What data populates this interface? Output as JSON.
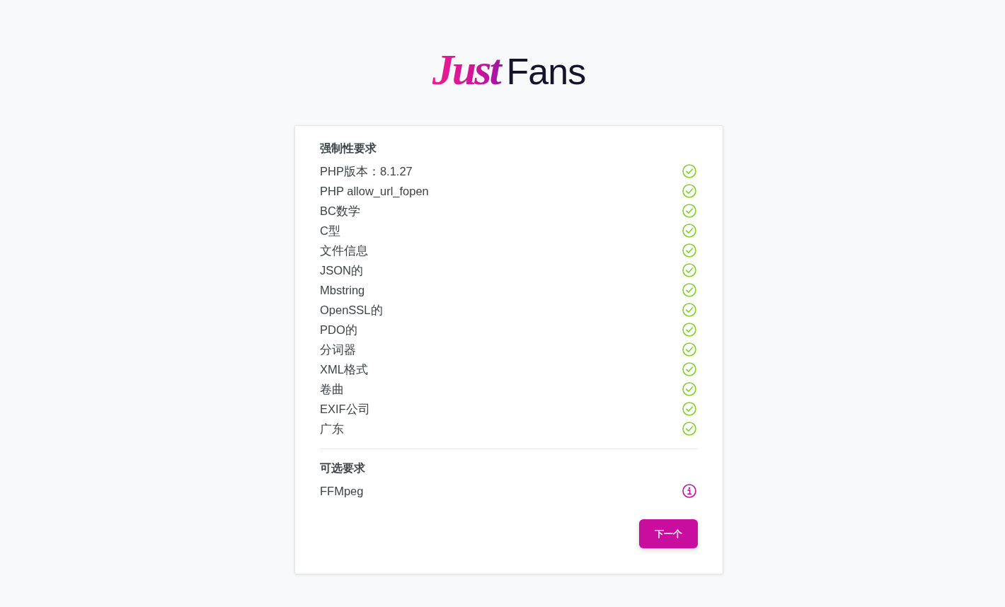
{
  "logo": {
    "script": "Just",
    "wordmark": "Fans"
  },
  "sections": [
    {
      "title": "强制性要求",
      "items": [
        {
          "name": "PHP版本：8.1.27",
          "passed": true
        },
        {
          "name": "PHP allow_url_fopen",
          "passed": true
        },
        {
          "name": "BC数学",
          "passed": true
        },
        {
          "name": "C型",
          "passed": true
        },
        {
          "name": "文件信息",
          "passed": true
        },
        {
          "name": "JSON的",
          "passed": true
        },
        {
          "name": "Mbstring",
          "passed": true
        },
        {
          "name": "OpenSSL的",
          "passed": true
        },
        {
          "name": "PDO的",
          "passed": true
        },
        {
          "name": "分词器",
          "passed": true
        },
        {
          "name": "XML格式",
          "passed": true
        },
        {
          "name": "卷曲",
          "passed": true
        },
        {
          "name": "EXIF公司",
          "passed": true
        },
        {
          "name": "广东",
          "passed": true
        }
      ]
    },
    {
      "title": "可选要求",
      "items": [
        {
          "name": "FFMpeg",
          "passed": false
        }
      ]
    }
  ],
  "next_button": {
    "label": "下一个"
  }
}
